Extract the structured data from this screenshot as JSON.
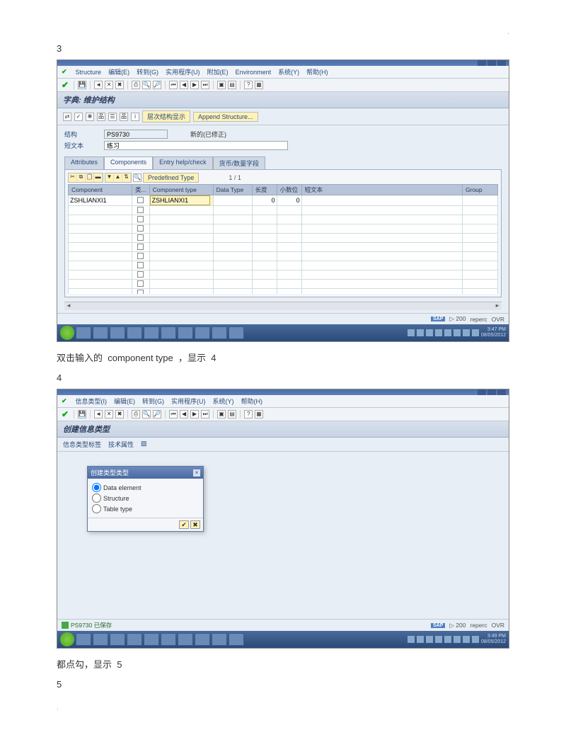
{
  "page_dot": ".",
  "step3_label": "3",
  "step4_label": "4",
  "step5_label": "5",
  "caption3": {
    "p1": "双击输入的",
    "p2": "component type",
    "p3": "，显示",
    "p4": "4"
  },
  "caption4": {
    "p1": "都点勾，显示",
    "p2": "5"
  },
  "shot1": {
    "menus": [
      "Structure",
      "编辑(E)",
      "转到(G)",
      "实用程序(U)",
      "附加(E)",
      "Environment",
      "系统(Y)",
      "帮助(H)"
    ],
    "title": "字典: 维护结构",
    "app_toolbar_link1": "层次结构显示",
    "app_toolbar_link2": "Append Structure...",
    "form": {
      "structure_label": "结构",
      "structure_value": "PS9730",
      "structure_status": "新的(已修正)",
      "shorttext_label": "短文本",
      "shorttext_value": "练习"
    },
    "tabs": [
      "Attributes",
      "Components",
      "Entry help/check",
      "货币/数量字段"
    ],
    "predef_type": "Predefined Type",
    "grid_count": "1 / 1",
    "grid_headers": [
      "Component",
      "类...",
      "Component type",
      "Data Type",
      "长度",
      "小数位",
      "短文本",
      "Group"
    ],
    "grid_rows": [
      {
        "component": "ZSHLIANXI1",
        "comptype": "ZSHLIANXI1",
        "len": "0",
        "dec": "0"
      }
    ],
    "status_right": {
      "host": "▷ 200",
      "client": "reperc",
      "sys": "OVR"
    },
    "tray_time": {
      "t": "3:47 PM",
      "d": "08/05/2012"
    }
  },
  "shot2": {
    "menus": [
      "信息类型(I)",
      "编辑(E)",
      "转到(G)",
      "实用程序(U)",
      "系统(Y)",
      "帮助(H)"
    ],
    "title": "创建信息类型",
    "subtabs": [
      "信息类型标签",
      "技术属性"
    ],
    "dialog": {
      "title": "创建类型类型",
      "opt1": "Data element",
      "opt2": "Structure",
      "opt3": "Table type"
    },
    "status_msg": "PS9730 已保存",
    "status_right": {
      "host": "▷ 200",
      "client": "reperc",
      "sys": "OVR"
    },
    "tray_time": {
      "t": "3:49 PM",
      "d": "08/05/2012"
    }
  }
}
